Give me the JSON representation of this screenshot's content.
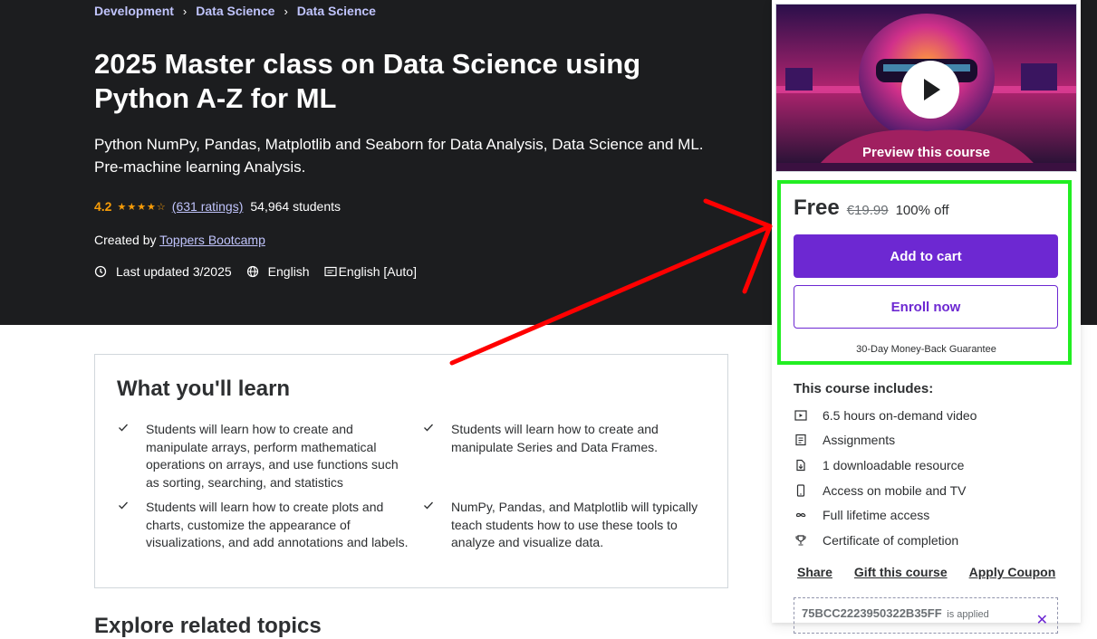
{
  "breadcrumb": [
    "Development",
    "Data Science",
    "Data Science"
  ],
  "course": {
    "title": "2025 Master class on Data Science using Python A-Z for ML",
    "subtitle": "Python NumPy, Pandas, Matplotlib and Seaborn for Data Analysis, Data Science and ML. Pre-machine learning Analysis.",
    "rating": "4.2",
    "stars": "★★★★☆",
    "ratings_count": "(631 ratings)",
    "students": "54,964 students",
    "created_by_label": "Created by",
    "instructor": "Toppers Bootcamp",
    "last_updated": "Last updated 3/2025",
    "language": "English",
    "captions": "English [Auto]"
  },
  "learn": {
    "title": "What you'll learn",
    "items": [
      "Students will learn how to create and manipulate arrays, perform mathematical operations on arrays, and use functions such as sorting, searching, and statistics",
      "Students will learn how to create and manipulate Series and Data Frames.",
      "Students will learn how to create plots and charts, customize the appearance of visualizations, and add annotations and labels.",
      "NumPy, Pandas, and Matplotlib will typically teach students how to use these tools to analyze and visualize data."
    ]
  },
  "next_section": "Explore related topics",
  "card": {
    "preview_label": "Preview this course",
    "price": "Free",
    "original_price": "€19.99",
    "discount": "100% off",
    "add_to_cart": "Add to cart",
    "enroll": "Enroll now",
    "guarantee": "30-Day Money-Back Guarantee",
    "includes_title": "This course includes:",
    "includes": [
      {
        "icon": "video-icon",
        "text": "6.5 hours on-demand video"
      },
      {
        "icon": "assignment-icon",
        "text": "Assignments"
      },
      {
        "icon": "download-icon",
        "text": "1 downloadable resource"
      },
      {
        "icon": "mobile-icon",
        "text": "Access on mobile and TV"
      },
      {
        "icon": "infinity-icon",
        "text": "Full lifetime access"
      },
      {
        "icon": "trophy-icon",
        "text": "Certificate of completion"
      }
    ],
    "links": [
      "Share",
      "Gift this course",
      "Apply Coupon"
    ],
    "coupon_code": "75BCC2223950322B35FF",
    "coupon_status": "is applied"
  },
  "colors": {
    "hero_bg": "#1c1d1f",
    "accent": "#6d28d2",
    "link": "#c0c4fc",
    "star": "#f69c08",
    "annotation_box": "#22ee22",
    "annotation_arrow": "#ff0000"
  }
}
